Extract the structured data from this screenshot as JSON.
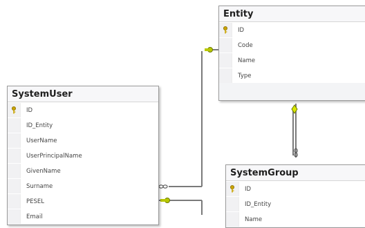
{
  "entity": {
    "title": "Entity",
    "columns": [
      {
        "name": "ID",
        "key": true
      },
      {
        "name": "Code",
        "key": false
      },
      {
        "name": "Name",
        "key": false
      },
      {
        "name": "Type",
        "key": false
      }
    ]
  },
  "system_user": {
    "title": "SystemUser",
    "columns": [
      {
        "name": "ID",
        "key": true
      },
      {
        "name": "ID_Entity",
        "key": false
      },
      {
        "name": "UserName",
        "key": false
      },
      {
        "name": "UserPrincipalName",
        "key": false
      },
      {
        "name": "GivenName",
        "key": false
      },
      {
        "name": "Surname",
        "key": false
      },
      {
        "name": "PESEL",
        "key": false
      },
      {
        "name": "Email",
        "key": false
      }
    ]
  },
  "system_group": {
    "title": "SystemGroup",
    "columns": [
      {
        "name": "ID",
        "key": true
      },
      {
        "name": "ID_Entity",
        "key": false
      },
      {
        "name": "Name",
        "key": false
      }
    ]
  },
  "colors": {
    "relationship_line": "#7a7a7a",
    "key_icon": "#c9a400",
    "connector_key": "#b9c800"
  }
}
